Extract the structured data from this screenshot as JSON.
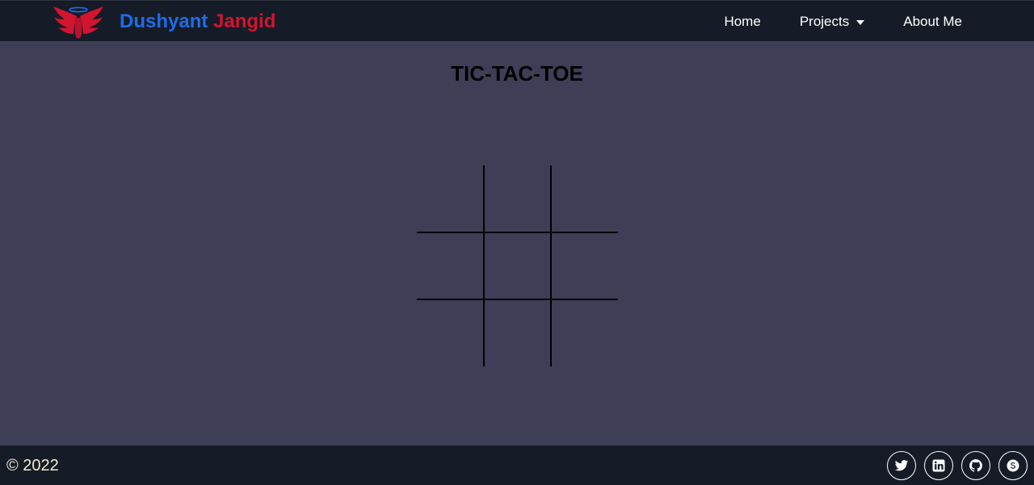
{
  "brand": {
    "first_name": "Dushyant",
    "last_name": "Jangid",
    "logo_icon": "winged-halo-logo"
  },
  "nav": {
    "items": [
      {
        "label": "Home"
      },
      {
        "label": "Projects",
        "icon": "caret-down-icon"
      },
      {
        "label": "About Me"
      }
    ]
  },
  "game": {
    "title": "TIC-TAC-TOE",
    "board": [
      "",
      "",
      "",
      "",
      "",
      "",
      "",
      "",
      ""
    ]
  },
  "footer": {
    "copyright": "© 2022",
    "socials": [
      "twitter-icon",
      "linkedin-icon",
      "github-icon",
      "skype-icon"
    ]
  },
  "colors": {
    "background": "#3f3e57",
    "navbar": "#161c27",
    "brand_first": "#1c6de9",
    "brand_last": "#d3142f",
    "grid_lines": "#000000",
    "copyright_text": "#f3ead0"
  }
}
